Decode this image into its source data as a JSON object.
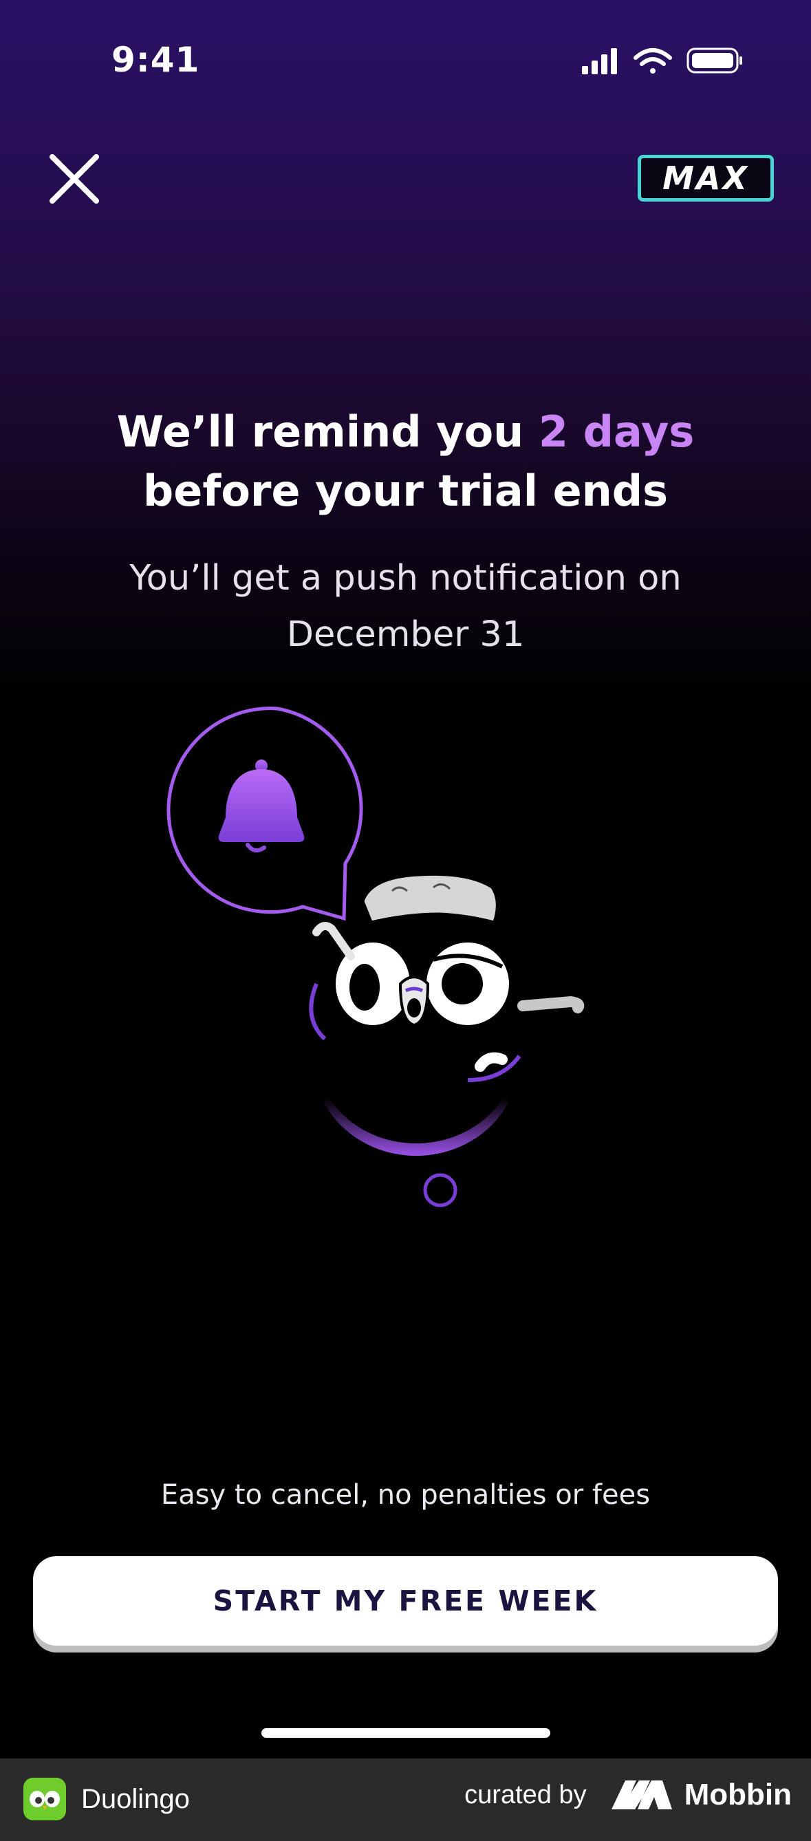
{
  "status_bar": {
    "time": "9:41"
  },
  "header": {
    "close_icon": "close-icon",
    "badge_label": "MAX"
  },
  "headline": {
    "part1": "We’ll remind you ",
    "highlight": "2 days",
    "part2": " before your trial ends"
  },
  "subtext": "You’ll get a push notification on December 31",
  "illustration": {
    "icon": "bell-icon"
  },
  "cancel_note": "Easy to cancel, no penalties or fees",
  "cta_label": "START MY FREE WEEK",
  "footer": {
    "app_name": "Duolingo",
    "curated_by": "curated by",
    "brand": "Mobbin"
  },
  "colors": {
    "accent": "#c985f5",
    "badge_border": "#47d5d5",
    "cta_text": "#1b1340"
  }
}
